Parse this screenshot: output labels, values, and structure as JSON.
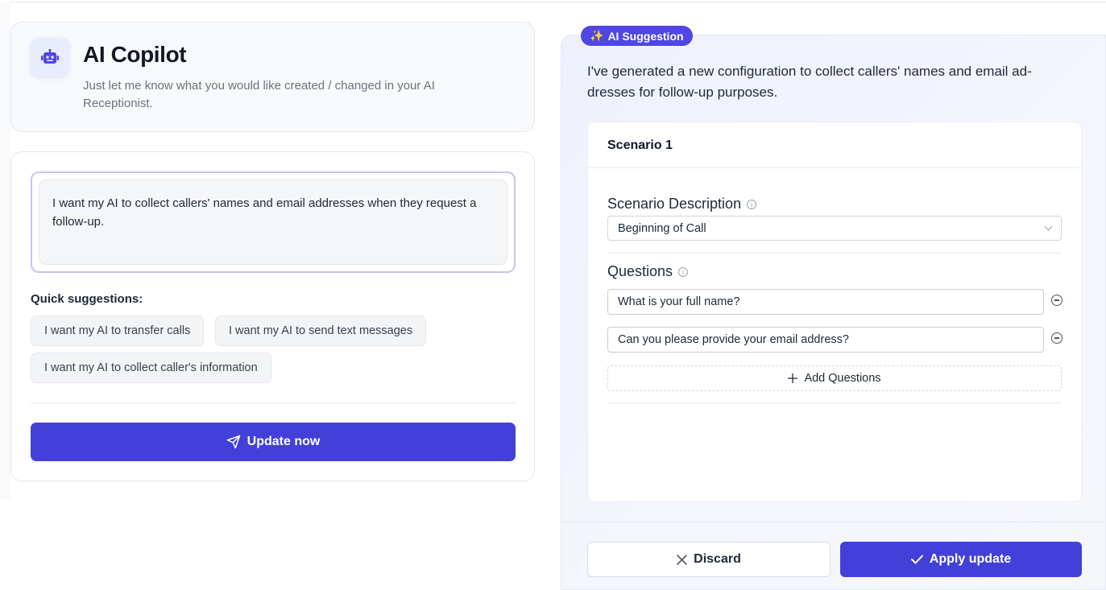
{
  "header": {
    "title": "AI Copilot",
    "subtitle": "Just let me know what you would like created / changed in your AI Receptionist.",
    "icon": "robot-icon"
  },
  "prompt": {
    "value": "I want my AI to collect callers' names and email addresses when they request a follow-up."
  },
  "quick_suggestions": {
    "label": "Quick suggestions:",
    "items": [
      "I want my AI to transfer calls",
      "I want my AI to send text messages",
      "I want my AI to collect caller's information"
    ]
  },
  "update_button": {
    "label": "Update now",
    "icon": "send-icon"
  },
  "suggestion": {
    "badge": "AI Suggestion",
    "badge_icon": "sparkles-icon",
    "message": "I've generated a new configuration to collect callers' names and email ad-dresses for follow-up purposes."
  },
  "scenario": {
    "title": "Scenario 1",
    "description_label": "Scenario Description",
    "description_value": "Beginning of Call",
    "questions_label": "Questions",
    "questions": [
      "What is your full name?",
      "Can you please provide your email address?"
    ],
    "add_questions_label": "Add Questions"
  },
  "actions": {
    "discard_label": "Discard",
    "apply_label": "Apply update"
  },
  "colors": {
    "primary": "#4340d9",
    "badge": "#4f46e5",
    "robot_icon": "#4f46e5"
  }
}
